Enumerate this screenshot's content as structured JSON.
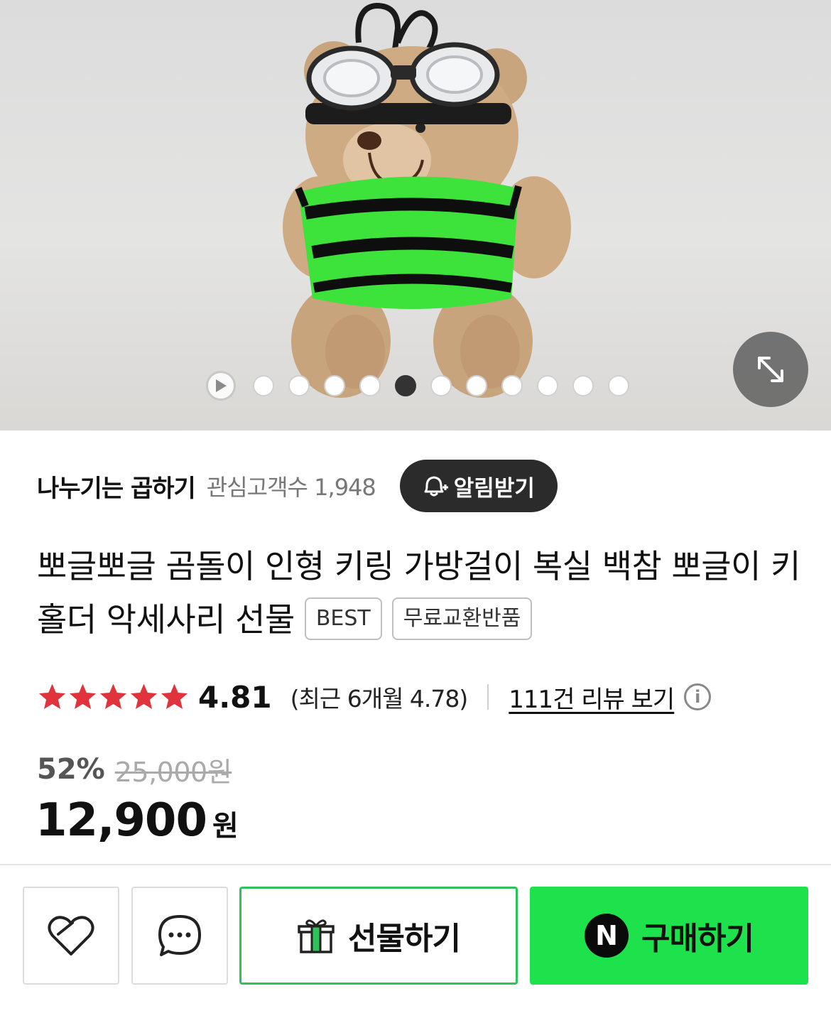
{
  "gallery": {
    "image_alt": "teddy bear keyring with goggles and green striped sweater",
    "slide_count": 12,
    "active_index": 5,
    "expand_icon": "expand-diagonal-icon",
    "play_icon": "play-icon"
  },
  "store": {
    "name": "나누기는 곱하기",
    "interest_label": "관심고객수 1,948",
    "notify_button": "알림받기",
    "notify_icon": "bell-plus-icon"
  },
  "product": {
    "title": "뽀글뽀글 곰돌이 인형 키링 가방걸이 복실 백참 뽀글이 키홀더 악세사리 선물",
    "tags": [
      "BEST",
      "무료교환반품"
    ]
  },
  "rating": {
    "stars": 5,
    "score": "4.81",
    "recent": "(최근 6개월 4.78)",
    "review_link": "111건 리뷰 보기",
    "info_icon": "info-icon",
    "star_color": "#e0333c"
  },
  "price": {
    "discount": "52%",
    "original": "25,000원",
    "current": "12,900",
    "unit": "원"
  },
  "bottom_bar": {
    "like_icon": "heart-icon",
    "chat_icon": "chat-bubble-icon",
    "gift_label": "선물하기",
    "gift_icon": "gift-box-icon",
    "buy_label": "구매하기",
    "buy_badge": "N",
    "accent_green": "#1ee24c"
  }
}
